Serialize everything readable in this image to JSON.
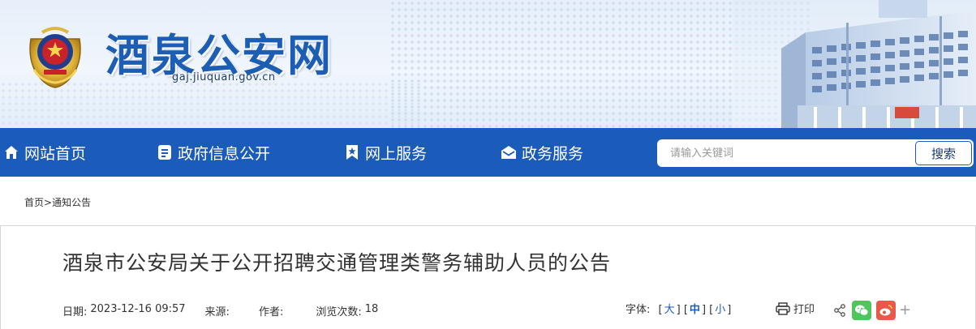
{
  "header": {
    "site_name": "酒泉公安网",
    "site_url": "gaj.jiuquan.gov.cn"
  },
  "nav": {
    "items": [
      {
        "label": "网站首页",
        "icon": "home-icon"
      },
      {
        "label": "政府信息公开",
        "icon": "document-icon"
      },
      {
        "label": "网上服务",
        "icon": "bookmark-star-icon"
      },
      {
        "label": "政务服务",
        "icon": "mail-icon"
      }
    ],
    "search": {
      "placeholder": "请输入关键词",
      "button_label": "搜索"
    }
  },
  "breadcrumb": {
    "home": "首页",
    "separator": ">",
    "current": "通知公告"
  },
  "article": {
    "title": "酒泉市公安局关于公开招聘交通管理类警务辅助人员的公告",
    "meta": {
      "date_label": "日期:",
      "date_value": "2023-12-16 09:57",
      "source_label": "来源:",
      "source_value": "",
      "author_label": "作者:",
      "author_value": "",
      "views_label": "浏览次数:",
      "views_value": "18"
    },
    "font_size": {
      "label": "字体:",
      "options": [
        "大",
        "中",
        "小"
      ],
      "selected": "中"
    },
    "print_label": "打印",
    "share": {
      "icons": [
        "share-icon",
        "wechat-icon",
        "weibo-icon"
      ],
      "more": "+"
    }
  },
  "colors": {
    "nav_bg": "#1b5bba",
    "title_blue": "#1d5eb5",
    "wechat_green": "#4fc55c",
    "weibo_red": "#e8594b"
  }
}
